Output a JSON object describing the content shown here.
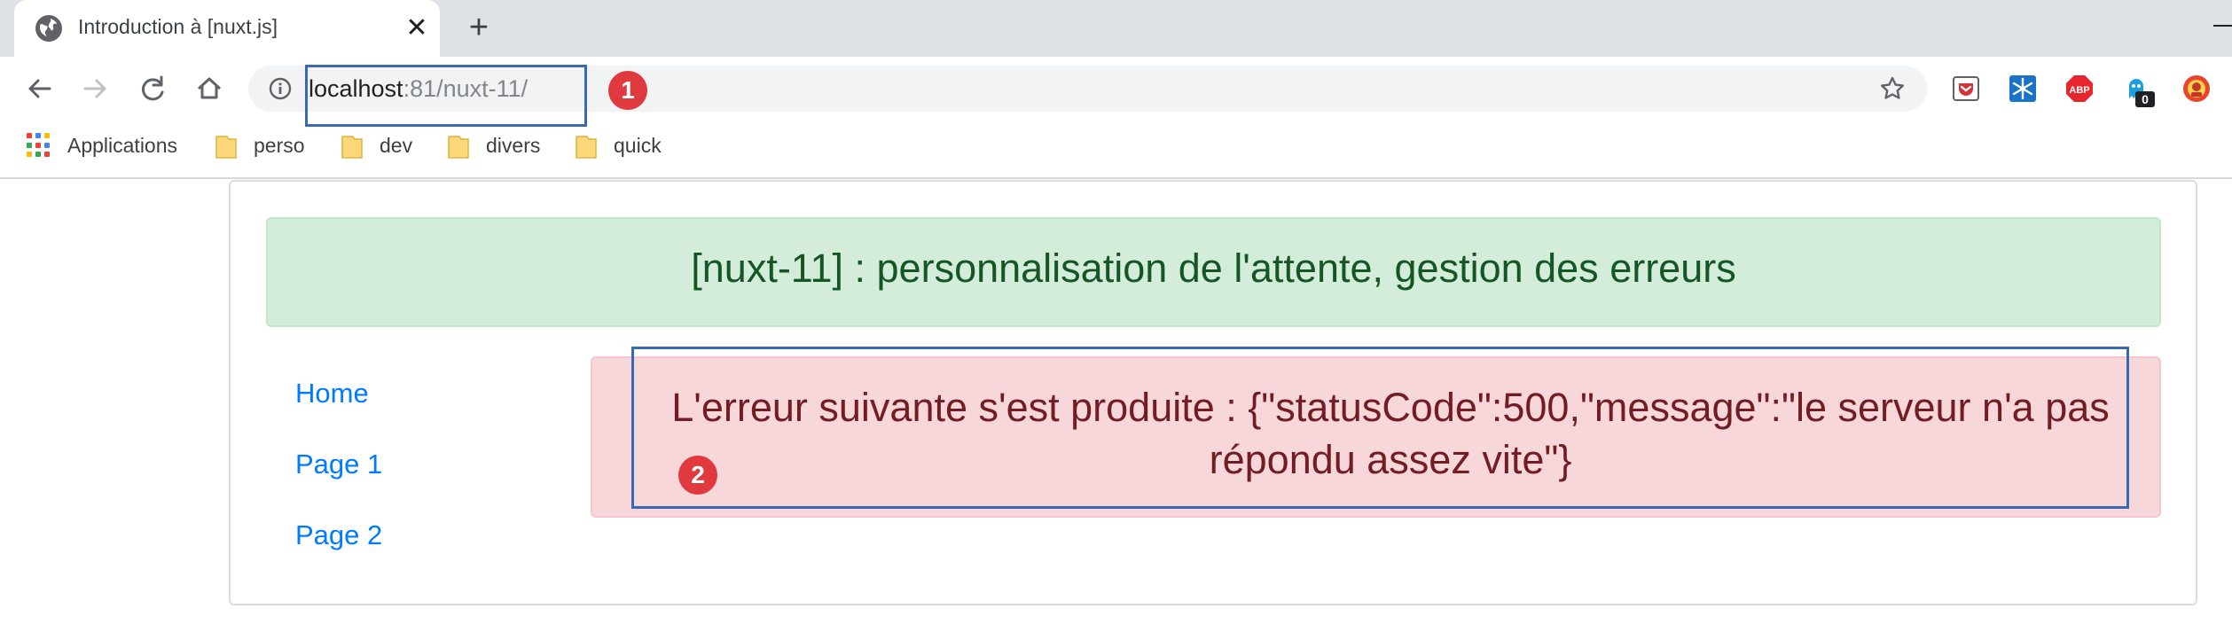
{
  "browser": {
    "tab": {
      "title": "Introduction à [nuxt.js]",
      "close_glyph": "✕",
      "favicon": "globe-icon"
    },
    "new_tab_glyph": "+",
    "url_host": "localhost",
    "url_rest": ":81/nuxt-11/",
    "extensions": [
      "pocket-icon",
      "snowflake-extension-icon",
      "adblock-plus-icon",
      "ghostery-icon",
      "extension-avatar-icon"
    ],
    "extension_badge": "0",
    "bookmarks": {
      "apps_label": "Applications",
      "folders": [
        "perso",
        "dev",
        "divers",
        "quick"
      ]
    }
  },
  "page": {
    "header_title": "[nuxt-11] : personnalisation de l'attente, gestion des erreurs",
    "nav": [
      "Home",
      "Page 1",
      "Page 2"
    ],
    "error_message": "L'erreur suivante s'est produite : {\"statusCode\":500,\"message\":\"le serveur n'a pas répondu assez vite\"}"
  },
  "annotations": {
    "marker_1": "1",
    "marker_2": "2"
  },
  "colors": {
    "header_bg": "#d4edda",
    "header_text": "#155724",
    "error_bg": "#f8d7da",
    "error_text": "#721c24",
    "link": "#007bff",
    "annotation_box": "#3a69b4",
    "annotation_marker": "#e03a3e"
  }
}
